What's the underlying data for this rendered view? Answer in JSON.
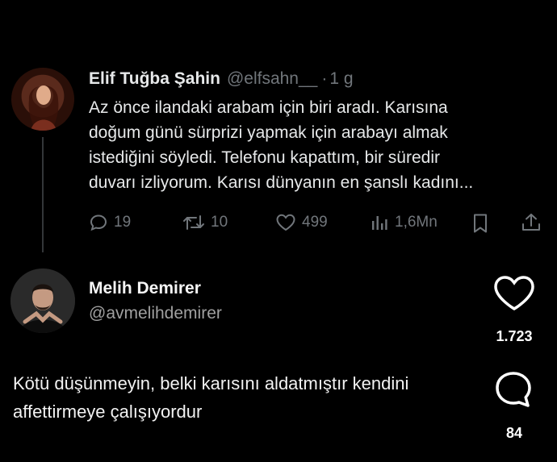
{
  "tweet": {
    "author_name": "Elif Tuğba Şahin",
    "handle": "@elfsahn__",
    "separator": "·",
    "time": "1 g",
    "text_lines": [
      "Az önce ilandaki arabam için biri aradı. Karısına",
      "doğum günü sürprizi yapmak için arabayı almak",
      "istediğini söyledi. Telefonu kapattım, bir süredir",
      "duvarı izliyorum. Karısı dünyanın en şanslı kadını..."
    ],
    "actions": {
      "replies": "19",
      "reposts": "10",
      "likes": "499",
      "views": "1,6Mn"
    }
  },
  "comment": {
    "author_name": "Melih Demirer",
    "handle": "@avmelihdemirer",
    "text_lines": [
      "Kötü düşünmeyin, belki karısını aldatmıştır kendini",
      "affettirmeye çalışıyordur"
    ],
    "like_count": "1.723",
    "comment_count": "84"
  },
  "colors": {
    "background": "#000000",
    "primary_text": "#e7e9ea",
    "secondary_text": "#71767b"
  }
}
